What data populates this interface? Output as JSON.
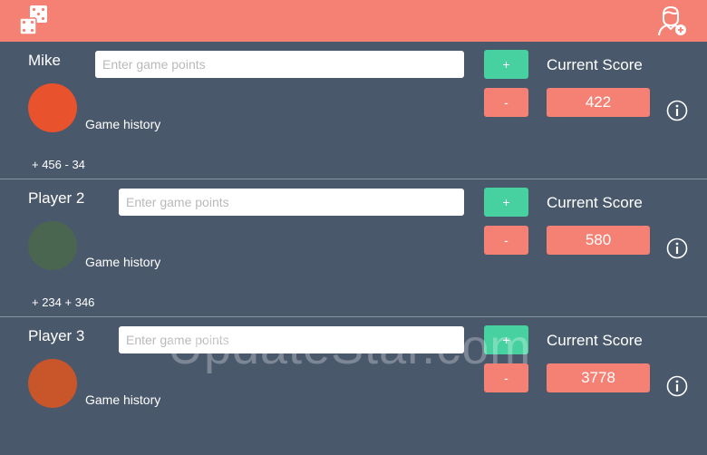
{
  "icons": {
    "dice": "dice-icon",
    "add_user": "add-user-icon",
    "info": "info-icon"
  },
  "colors": {
    "header": "#f48173",
    "background": "#4a586b",
    "plus_button": "#48d1a0",
    "minus_button": "#f48173",
    "score_box": "#f48173"
  },
  "players": [
    {
      "name": "Mike",
      "input_placeholder": "Enter game points",
      "input_value": "",
      "plus_label": "+",
      "minus_label": "-",
      "score_label": "Current Score",
      "score": "422",
      "history_label": "Game history",
      "history": "+ 456 - 34",
      "color": "#e8522d"
    },
    {
      "name": "Player 2",
      "input_placeholder": "Enter game points",
      "input_value": "",
      "plus_label": "+",
      "minus_label": "-",
      "score_label": "Current Score",
      "score": "580",
      "history_label": "Game history",
      "history": "+ 234 + 346",
      "color": "#4a6650"
    },
    {
      "name": "Player 3",
      "input_placeholder": "Enter game points",
      "input_value": "",
      "plus_label": "+",
      "minus_label": "-",
      "score_label": "Current Score",
      "score": "3778",
      "history_label": "Game history",
      "history": "",
      "color": "#c8562a"
    }
  ],
  "watermark": "UpdateStar.com"
}
